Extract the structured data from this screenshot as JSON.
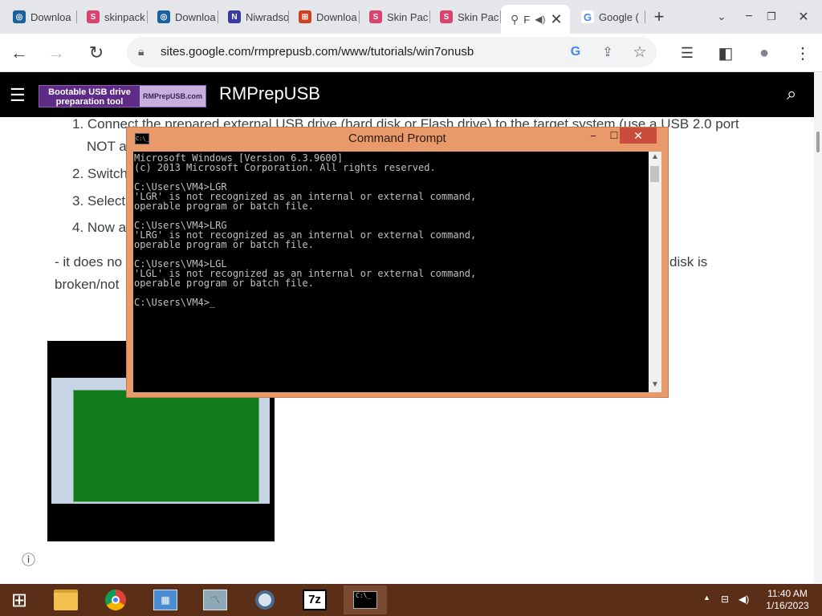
{
  "browser": {
    "tabs": [
      {
        "label": "Downloa",
        "icon": "page-icon",
        "color": "#1a5fa0"
      },
      {
        "label": "skinpack",
        "icon": "sp-icon",
        "color": "#d9436c"
      },
      {
        "label": "Downloa",
        "icon": "page-icon",
        "color": "#1a5fa0"
      },
      {
        "label": "Niwradso",
        "icon": "app-icon",
        "color": "#3a3aa0"
      },
      {
        "label": "Downloa",
        "icon": "windows-icon",
        "color": "#d04020"
      },
      {
        "label": "Skin Pac",
        "icon": "sp-icon",
        "color": "#d9436c"
      },
      {
        "label": "Skin Pac",
        "icon": "sp-icon",
        "color": "#d9436c"
      },
      {
        "label": "F",
        "icon": "usb-icon",
        "color": "#555555"
      },
      {
        "label": "Google (",
        "icon": "google-icon",
        "color": "#4285f4"
      }
    ],
    "url": "sites.google.com/rmprepusb.com/www/tutorials/win7onusb"
  },
  "site": {
    "logo_left": "Bootable USB drive preparation tool",
    "logo_right": "RMPrepUSB.com",
    "title": "RMPrepUSB"
  },
  "content": {
    "item1_line1": "1. Connect the prepared external USB drive (hard disk or Flash drive) to the target system (use a USB 2.0 port",
    "item1_line2": "NOT a",
    "item2": "2. Switch",
    "item3": "3. Select",
    "item4": "4. Now a",
    "note_line1_start": "- it does no",
    "note_line1_end": "disk is",
    "note_line2": "broken/not"
  },
  "cmd": {
    "title": "Command Prompt",
    "icon_text": "C:\\_",
    "console": "Microsoft Windows [Version 6.3.9600]\n(c) 2013 Microsoft Corporation. All rights reserved.\n\nC:\\Users\\VM4>LGR\n'LGR' is not recognized as an internal or external command,\noperable program or batch file.\n\nC:\\Users\\VM4>LRG\n'LRG' is not recognized as an internal or external command,\noperable program or batch file.\n\nC:\\Users\\VM4>LGL\n'LGL' is not recognized as an internal or external command,\noperable program or batch file.\n\nC:\\Users\\VM4>_"
  },
  "taskbar": {
    "time": "11:40 AM",
    "date": "1/16/2023",
    "apps": [
      "start-icon",
      "file-explorer-icon",
      "chrome-icon",
      "control-panel-icon",
      "performance-icon",
      "search-tool-icon",
      "7zip-icon",
      "cmd-icon"
    ],
    "zip_label": "7z"
  },
  "colors": {
    "taskbar": "#5b2e18",
    "cmd_frame": "#e99a6a",
    "close_button": "#c94c3c",
    "logo_purple": "#5e2b87"
  }
}
